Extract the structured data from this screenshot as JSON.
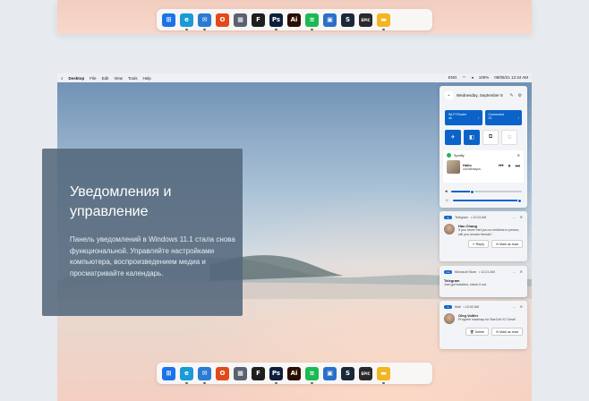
{
  "menubar": {
    "app": "Desktop",
    "items": [
      "File",
      "Edit",
      "View",
      "Tools",
      "Help"
    ],
    "status": [
      "ENG",
      "100%",
      "09/05/21 12:34 AM"
    ]
  },
  "info_card": {
    "title": "Уведомления и управление",
    "body": "Панель уведомлений в Windows 11.1 стала снова функциональной. Управляйте настройками компьютера, воспроизведением медиа и просматривайте календарь."
  },
  "quick_settings": {
    "date": "Wednesday, September 8",
    "tiles": {
      "wifi_title": "Wi-Fi Router",
      "wifi_sub": "ok",
      "bt_title": "Connected",
      "bt_sub": "01"
    },
    "media": {
      "source": "Spotify",
      "track": "Hallo",
      "artist": "clondthatyou"
    }
  },
  "notifications": [
    {
      "app": "Telegram",
      "time": "• 12:24 AM",
      "sender": "Hau Chang",
      "message": "If you never met you so reckless in person, will you remain friends?",
      "actions": [
        "Reply",
        "Mark as read"
      ]
    },
    {
      "app": "Microsoft Store",
      "time": "• 12:21 AM",
      "sender": "Telegram",
      "message": "Just got installed, check it out."
    },
    {
      "app": "Mail",
      "time": "• 10:02 AM",
      "sender": "Oleg Voitler",
      "message": "Program roadmap for StarCell V2 Gmail",
      "actions": [
        "Delete",
        "Mark as read"
      ]
    }
  ],
  "taskbar_apps": [
    {
      "name": "start",
      "color": "#1a73e8",
      "glyph": "⊞"
    },
    {
      "name": "edge",
      "color": "#1a9bd7",
      "glyph": "e"
    },
    {
      "name": "mail",
      "color": "#2a7bd4",
      "glyph": "✉"
    },
    {
      "name": "office",
      "color": "#e24a1a",
      "glyph": "O"
    },
    {
      "name": "calculator",
      "color": "#5a6270",
      "glyph": "▦"
    },
    {
      "name": "figma",
      "color": "#1e1e1e",
      "glyph": "F"
    },
    {
      "name": "photoshop",
      "color": "#0d1f3c",
      "glyph": "Ps"
    },
    {
      "name": "illustrator",
      "color": "#2b0d00",
      "glyph": "Ai"
    },
    {
      "name": "spotify",
      "color": "#1db954",
      "glyph": "≋"
    },
    {
      "name": "store",
      "color": "#2a6fc9",
      "glyph": "▣"
    },
    {
      "name": "steam",
      "color": "#1b2838",
      "glyph": "S"
    },
    {
      "name": "epic",
      "color": "#2a2a2a",
      "glyph": "EPIC"
    },
    {
      "name": "explorer",
      "color": "#f2b620",
      "glyph": "▬"
    }
  ]
}
